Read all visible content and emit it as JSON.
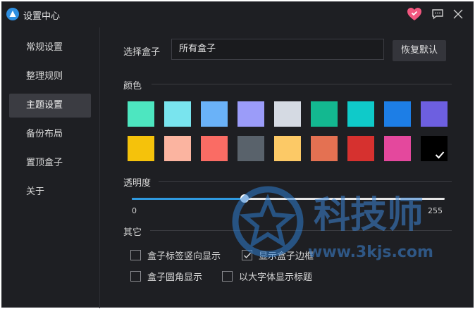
{
  "window": {
    "title": "设置中心"
  },
  "sidebar": {
    "items": [
      {
        "label": "常规设置"
      },
      {
        "label": "整理规则"
      },
      {
        "label": "主题设置",
        "active": true
      },
      {
        "label": "备份布局"
      },
      {
        "label": "置顶盒子"
      },
      {
        "label": "关于"
      }
    ]
  },
  "box_select": {
    "label": "选择盒子",
    "value": "所有盒子",
    "restore_label": "恢复默认"
  },
  "color_section": {
    "label": "颜色",
    "selected": "#000000",
    "row1": [
      "#4de6c0",
      "#79e4ee",
      "#6ab2f8",
      "#9b9cf9",
      "#d5dae3",
      "#13b890",
      "#0fcac9",
      "#1d7ee6",
      "#6d5fe0"
    ],
    "row2": [
      "#f5c20b",
      "#fbb4a0",
      "#fa6c64",
      "#59626b",
      "#fcc966",
      "#e47152",
      "#d6312f",
      "#e4489d",
      "#000000"
    ]
  },
  "opacity": {
    "label": "透明度",
    "min": "0",
    "max": "255",
    "value": 92
  },
  "other": {
    "label": "其它",
    "options": [
      {
        "label": "盒子标签竖向显示",
        "checked": false
      },
      {
        "label": "显示盒子边框",
        "checked": true
      },
      {
        "label": "盒子圆角显示",
        "checked": false
      },
      {
        "label": "以大字体显示标题",
        "checked": false
      }
    ]
  },
  "watermark": {
    "brand": "科技师",
    "url": "www.3kjs.com"
  },
  "colors": {
    "accent": "#2f9ae0",
    "background": "#1e1f23",
    "heart": "#f2577f"
  }
}
